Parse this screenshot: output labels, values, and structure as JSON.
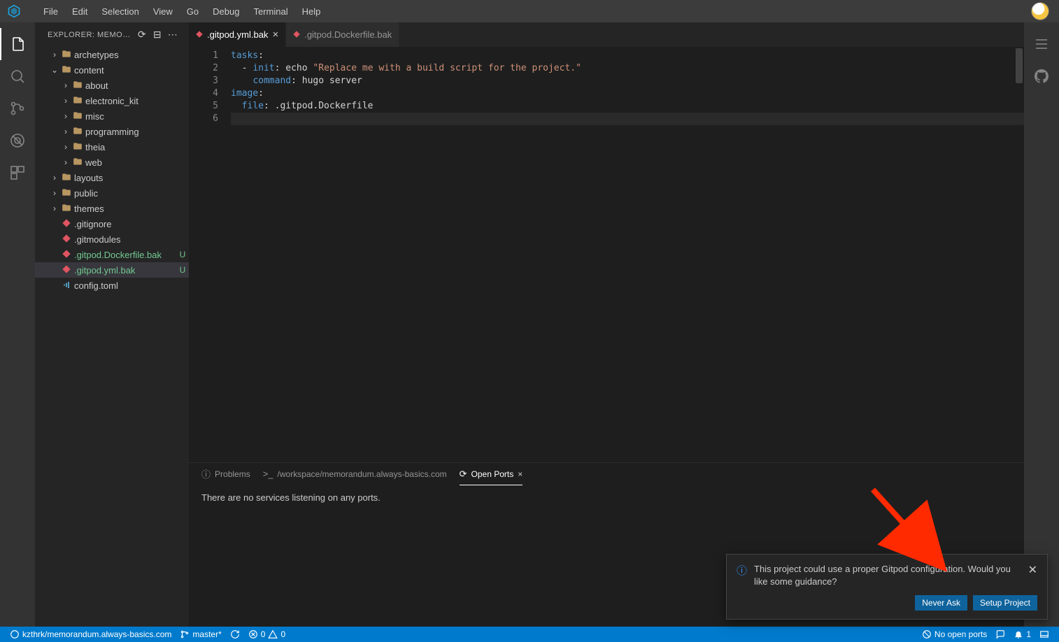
{
  "menubar": {
    "items": [
      "File",
      "Edit",
      "Selection",
      "View",
      "Go",
      "Debug",
      "Terminal",
      "Help"
    ]
  },
  "sidebar": {
    "header": "EXPLORER: MEMORAN...",
    "tree": [
      {
        "indent": 1,
        "twisty": "›",
        "type": "folder",
        "label": "archetypes"
      },
      {
        "indent": 1,
        "twisty": "⌄",
        "type": "folder",
        "label": "content"
      },
      {
        "indent": 2,
        "twisty": "›",
        "type": "folder",
        "label": "about"
      },
      {
        "indent": 2,
        "twisty": "›",
        "type": "folder",
        "label": "electronic_kit"
      },
      {
        "indent": 2,
        "twisty": "›",
        "type": "folder",
        "label": "misc"
      },
      {
        "indent": 2,
        "twisty": "›",
        "type": "folder",
        "label": "programming"
      },
      {
        "indent": 2,
        "twisty": "›",
        "type": "folder",
        "label": "theia"
      },
      {
        "indent": 2,
        "twisty": "›",
        "type": "folder",
        "label": "web"
      },
      {
        "indent": 1,
        "twisty": "›",
        "type": "folder",
        "label": "layouts"
      },
      {
        "indent": 1,
        "twisty": "›",
        "type": "folder",
        "label": "public"
      },
      {
        "indent": 1,
        "twisty": "›",
        "type": "folder",
        "label": "themes"
      },
      {
        "indent": 1,
        "twisty": "",
        "type": "git",
        "label": ".gitignore"
      },
      {
        "indent": 1,
        "twisty": "",
        "type": "git",
        "label": ".gitmodules"
      },
      {
        "indent": 1,
        "twisty": "",
        "type": "git",
        "label": ".gitpod.Dockerfile.bak",
        "status": "U"
      },
      {
        "indent": 1,
        "twisty": "",
        "type": "git",
        "label": ".gitpod.yml.bak",
        "status": "U",
        "selected": true
      },
      {
        "indent": 1,
        "twisty": "",
        "type": "conf",
        "label": "config.toml"
      }
    ]
  },
  "tabs": [
    {
      "label": ".gitpod.yml.bak",
      "active": true,
      "modified": true
    },
    {
      "label": ".gitpod.Dockerfile.bak",
      "active": false,
      "modified": true
    }
  ],
  "editor": {
    "lines": [
      {
        "num": "1",
        "html": "<span class='tok-key'>tasks</span>:"
      },
      {
        "num": "2",
        "html": "  - <span class='tok-key'>init</span>: echo <span class='tok-str'>\"Replace me with a build script for the project.\"</span>"
      },
      {
        "num": "3",
        "html": "    <span class='tok-key'>command</span>: hugo server"
      },
      {
        "num": "4",
        "html": "<span class='tok-key'>image</span>:"
      },
      {
        "num": "5",
        "html": "  <span class='tok-key'>file</span>: .gitpod.Dockerfile"
      },
      {
        "num": "6",
        "html": "",
        "current": true
      }
    ]
  },
  "panel": {
    "tabs": [
      {
        "icon": "ⓘ",
        "label": "Problems",
        "active": false
      },
      {
        "icon": ">_",
        "label": "/workspace/memorandum.always-basics.com",
        "active": false
      },
      {
        "icon": "⟳",
        "label": "Open Ports",
        "active": true,
        "closable": true
      }
    ],
    "body": "There are no services listening on any ports."
  },
  "notification": {
    "text": "This project could use a proper Gitpod configuration. Would you like some guidance?",
    "actions": [
      "Never Ask",
      "Setup Project"
    ]
  },
  "statusbar": {
    "left": {
      "repo": "kzthrk/memorandum.always-basics.com",
      "branch": "master*",
      "errors": "0",
      "warnings": "0"
    },
    "right": {
      "ports": "No open ports",
      "notifications": "1"
    }
  }
}
